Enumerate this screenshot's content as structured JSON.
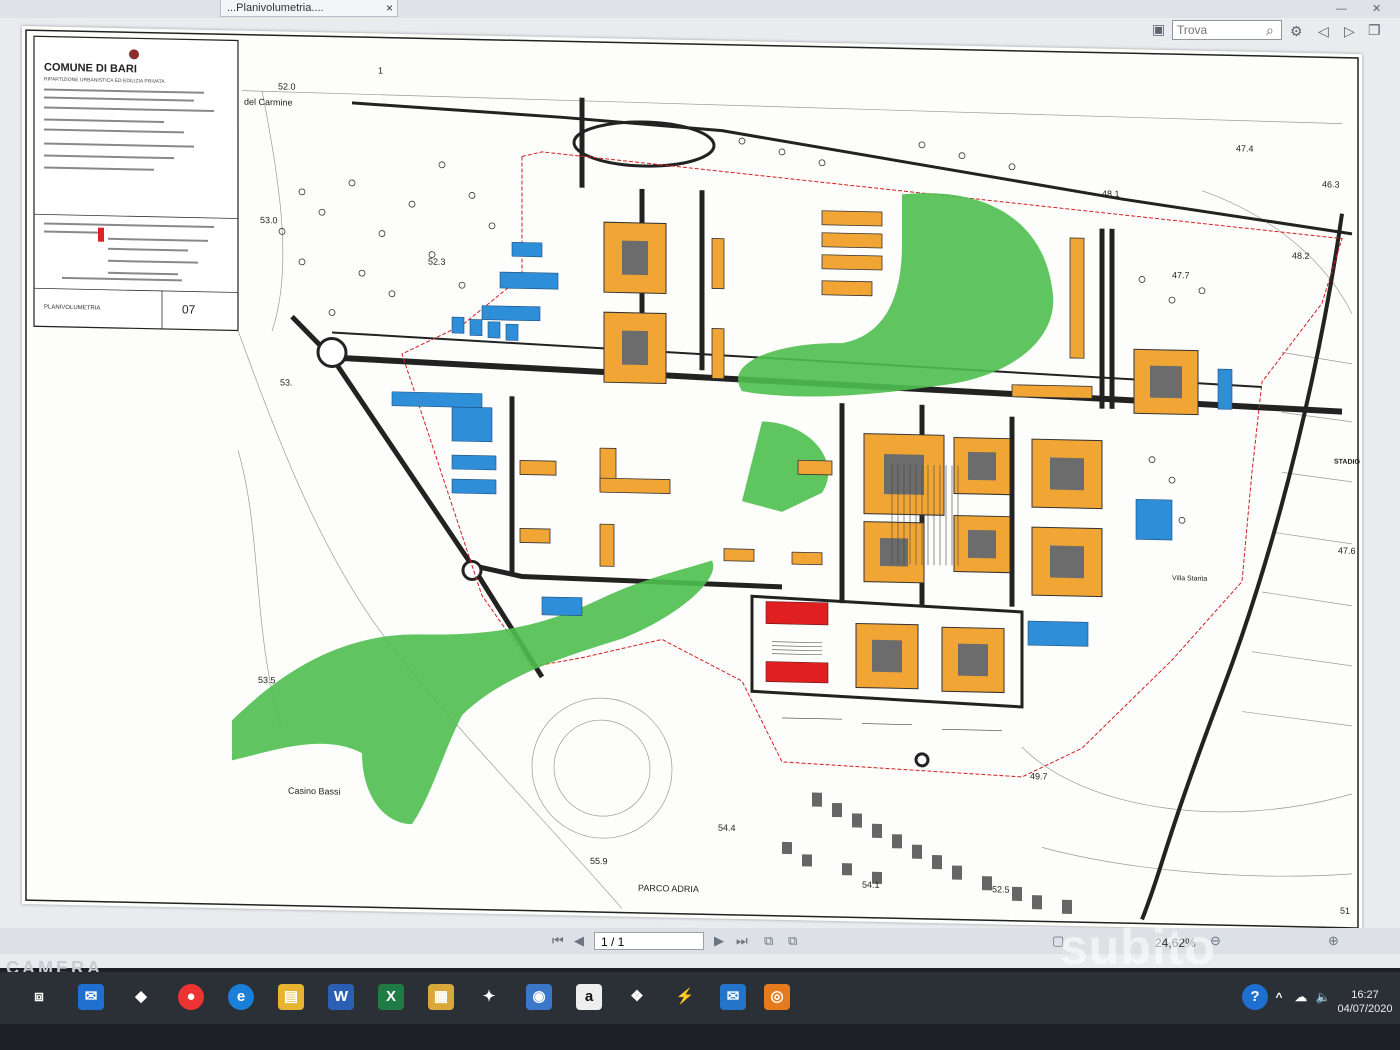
{
  "viewer": {
    "tab_title": "...Planivolumetria....",
    "tab_close": "×",
    "find_placeholder": "Trova",
    "page_indicator": "1 / 1",
    "zoom": "24,62%"
  },
  "title_block": {
    "municipality": "COMUNE DI BARI",
    "department": "RIPARTIZIONE URBANISTICA ED EDILIZIA PRIVATA",
    "sheet_title": "PLANIVOLUMETRIA",
    "sheet_number": "07"
  },
  "map_labels": {
    "street_carmine": "del Carmine",
    "stadium": "STADIO SAN NICOLA",
    "villa": "Villa Starita",
    "casino": "Casino Bassi",
    "park": "PARCO ADRIA",
    "elevations": [
      "52.0",
      "53.0",
      "52.3",
      "53.",
      "53.5",
      "55.9",
      "54.4",
      "54.1",
      "52.5",
      "51",
      "49.7",
      "47.6",
      "47.7",
      "48.2",
      "48.1",
      "47.4",
      "46.3"
    ],
    "parcel_1": "1"
  },
  "taskbar": {
    "time": "16:27",
    "date": "04/07/2020",
    "apps": [
      "Task View",
      "Mail",
      "Dropbox",
      "Chrome",
      "Edge",
      "Files",
      "Word",
      "Excel",
      "Explorer",
      "Gallery",
      "Store",
      "Amazon",
      "Dropbox",
      "Network",
      "Outlook",
      "App"
    ]
  },
  "overlays": {
    "camera_text": "CAMERA",
    "watermark": "subito"
  },
  "colors": {
    "orange_building": "#f0a535",
    "blue_building": "#2e8fd8",
    "red_building": "#e02020",
    "green_park": "#4fbf4f",
    "boundary_line": "#d02020"
  }
}
